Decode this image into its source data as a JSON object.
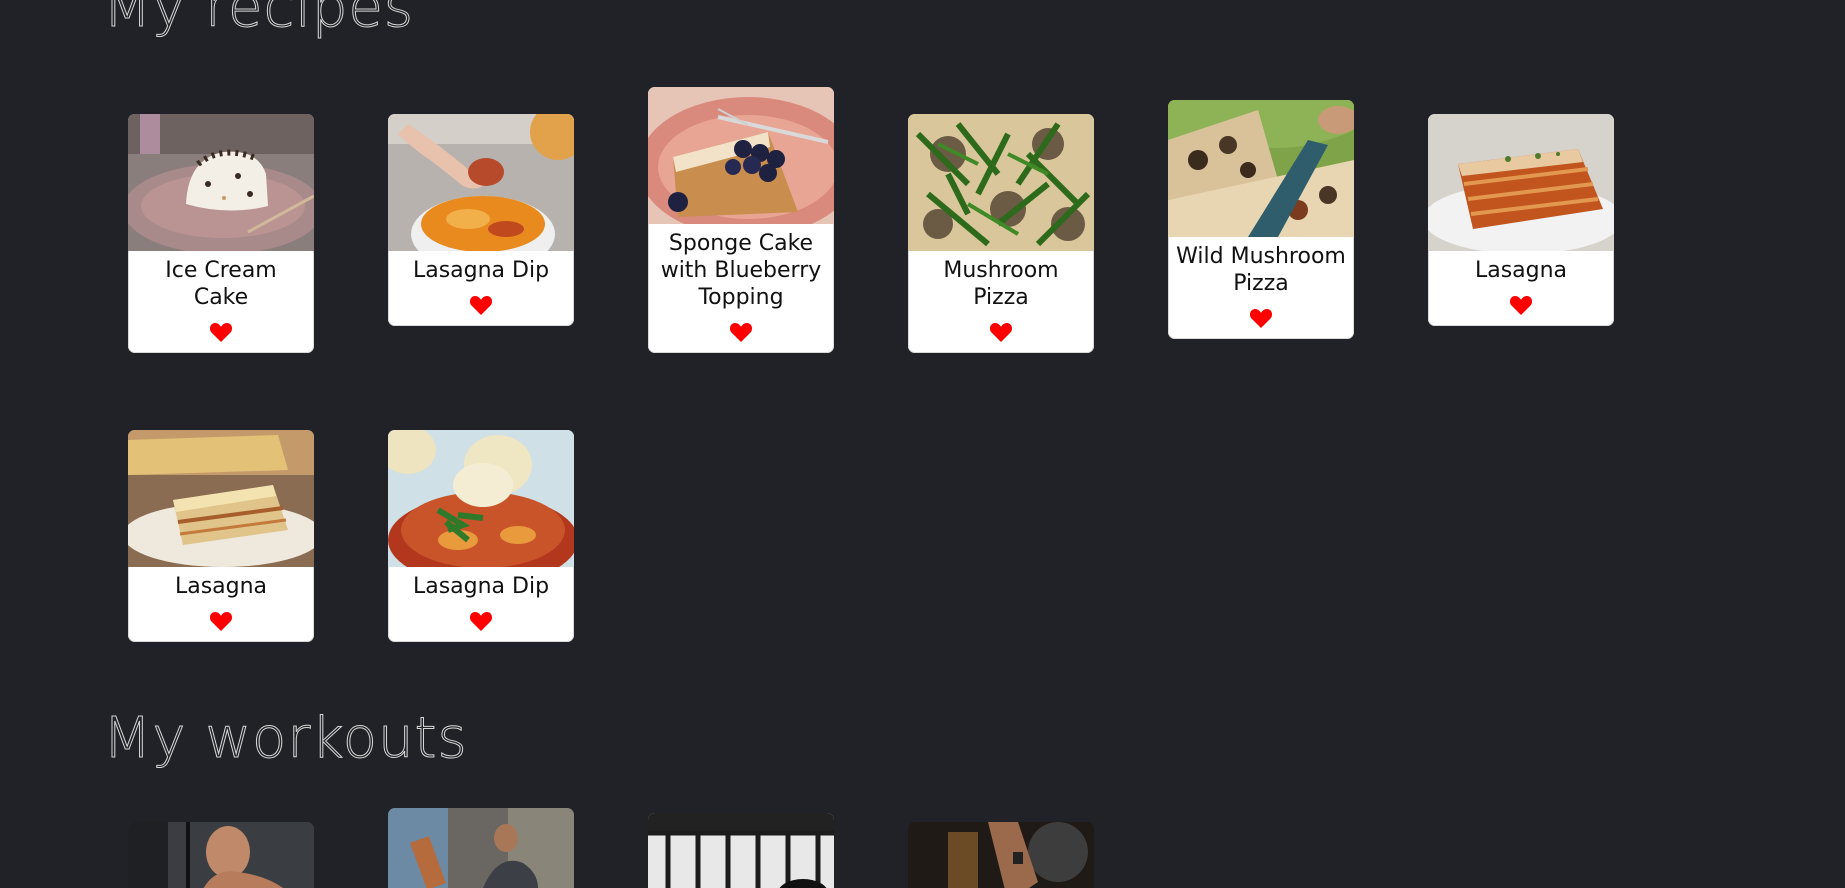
{
  "sections": {
    "recipes_title": "My recipes",
    "workouts_title": "My workouts"
  },
  "colors": {
    "background": "#202227",
    "card": "#ffffff",
    "heart": "#ff0000",
    "title_outline": "#d8d8d8"
  },
  "recipes": [
    {
      "title": "Ice Cream Cake",
      "favorite": true,
      "image": "ice-cream-cake-photo"
    },
    {
      "title": "Lasagna Dip",
      "favorite": true,
      "image": "lasagna-dip-photo"
    },
    {
      "title": "Sponge Cake with Blueberry Topping",
      "favorite": true,
      "image": "sponge-cake-photo"
    },
    {
      "title": "Mushroom Pizza",
      "favorite": true,
      "image": "mushroom-pizza-photo"
    },
    {
      "title": "Wild Mushroom Pizza",
      "favorite": true,
      "image": "wild-mushroom-pizza-photo"
    },
    {
      "title": "Lasagna",
      "favorite": true,
      "image": "lasagna-photo"
    },
    {
      "title": "Lasagna",
      "favorite": true,
      "image": "lasagna-photo"
    },
    {
      "title": "Lasagna Dip",
      "favorite": true,
      "image": "lasagna-dip-photo"
    }
  ],
  "workouts": [
    {
      "image": "cable-workout-photo"
    },
    {
      "image": "gym-trainer-photo"
    },
    {
      "image": "gym-interior-photo"
    },
    {
      "image": "dumbbell-workout-photo"
    }
  ]
}
